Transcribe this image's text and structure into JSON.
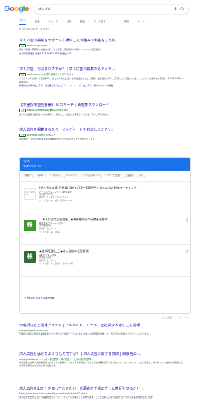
{
  "header": {
    "logo": [
      "G",
      "o",
      "o",
      "g",
      "l",
      "e"
    ],
    "query": "求人 広告"
  },
  "tabs": {
    "all": "すべて",
    "news": "ニュース",
    "shopping": "画像",
    "images": "地図",
    "videos": "動画",
    "more": "もっと見る",
    "settings": "設定",
    "tools": "ツール"
  },
  "stats": "約 137,000,000 件 （0.51 秒）",
  "ads": [
    {
      "title": "求人広告の掲載をサポート｜媒体ごとの強み・料金をご案内",
      "badge": "広告",
      "url": "www.one-group.jp/",
      "snippet": "媒体・職種・予算別に最適なプランをご提案。期間限定の特別キャンペーンを実施中！",
      "address": "東京都新宿区 新宿4-3-25 TOKYU REIT 新宿ビル4F"
    },
    {
      "title": "求人広告、お決まりですか？ | 求人広告の掲載ならアイデム",
      "badge": "広告",
      "url": "www.aidem.co.jp/求人情報サイト/アイデム",
      "snippet": "ユラスマッチを用いて定着率UP！ 欲しい人材にお会いする最適な方法をご提案！電話相談はOK。ご不要にのご相談をお任せ・こだわった採用をお手伝い・1,519,068件～掲載可能。",
      "sitelinks": "新聞折込の求人はコチラ　正社員の求人はコチラ　フリーペーパーはコチラ　求人サイトへの掲載"
    },
    {
      "title": "【中途採用担当者様】 ビズリーチ | 価格表ダウンロード",
      "badge": "広告",
      "url": "asuete.bizreach.biz/ ▼ 0120-953-850",
      "snippet": "多くの企業様で優秀な人材の採用を、採用コスト最適化を実現しています。テレビCM放映中。"
    },
    {
      "title": "求人広告を掲載するなら | インディードをお試しください。",
      "badge": "広告",
      "url": "jp.indeed.com/広告/求人",
      "snippet": "Indeedで、採用企業様を必要な求職者の方とのベストマッチをお手伝いします"
    }
  ],
  "jobs": {
    "title": "求人",
    "subtitle": "東京都千代田区 付近",
    "chips": [
      "職種",
      "分類",
      "3 日以内",
      "フルタイム",
      "コンピュータ、IT",
      "メディア、広告",
      "正社員",
      "社"
    ],
    "items": [
      {
        "logo_text": "テンプスタッフ",
        "title": "[紹介予定派遣]正社員/月給￥291〜353万円！求人広告の制作ライティング",
        "company": "パーソルテンプスタッフ株式会社",
        "location": "東京都千代田区",
        "via": "提供元: エン派遣・エンジャパン",
        "tags": [
          "2 日前",
          "派遣",
          "月額 ¥ 1,500"
        ]
      },
      {
        "logo_text": "株",
        "logo_color": "#3c9a2c",
        "title": "「求人広告の企画営業」◆異業種からの転職者活躍中",
        "company": "株式会社アド・イーグル",
        "location": "東京都台東区",
        "via": "提供元: はたらいく",
        "tags": [
          "3 日前",
          "正社員"
        ]
      },
      {
        "logo_text": "株",
        "logo_color": "#2e6d31",
        "title": "◆週休2日制土日◆求人広告の企画営業",
        "company": "(株)アドマックス",
        "location": "東京都渋谷区",
        "via": "提供元: はたらいく",
        "tags": [
          "3 日前",
          "正社員",
          "月額 ¥ 25万"
        ]
      }
    ],
    "more": "他 100 件以上の求人情報"
  },
  "feedback": {
    "more": "もっと見る",
    "feedback": "フィードバック"
  },
  "organic": [
    {
      "title": "日曜折込ちど情報アイテム | アルバイト、パート、正社員求人はしごと情報 ...",
      "url": "https://shigoto-joho.com/",
      "snippet": "日曜折込求人に関する情報をまとめた折込ちど情報アイテムはちのスタッフが原稿の作成・を、折込広告の配信までサポートいたします。"
    },
    {
      "title": "求人広告とはどのようなものですか？ | 求人広告に関する質問 | 飲食店の ...",
      "url": "https://cookbiz.jp/ › ... › よくある質問 › 求人広告サービスに関する質問",
      "snippet": "求人広告とは求人の掲載媒体にどのような種類や、どのような情報を、どのような効果が得られるのかなど。をよく求人サイト上に掲載し、求人サイトに訪れた求職者からの応募を受けつけるのも求人広告です。",
      "rating": ""
    },
    {
      "title": "求人広告を出すとき知っておきたい | 応募者の立場に立った表記をすること ...",
      "url": "https://www.jinzai-info.net/useful/hr-solution/first/first03.php",
      "snippet": "求人広告を出す上でどの掲載方法がよいかどうかよりも大事なことがあります。ここでは求人広告の掲載を出す方の注意事項をお伝えします。"
    }
  ]
}
